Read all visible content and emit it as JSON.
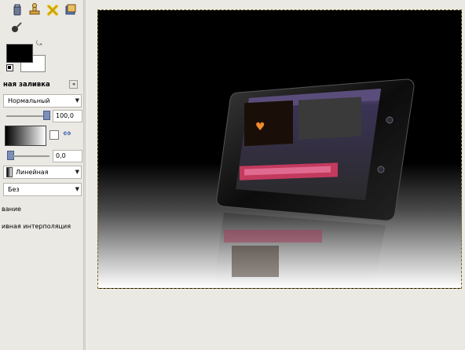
{
  "options": {
    "title": "ная заливка",
    "mode": "Нормальный",
    "opacity": "100,0",
    "offset": "0,0",
    "shape": "Линейная",
    "repeat": "Без",
    "label1": "вание",
    "label2": "ивная интерполяция"
  },
  "colors": {
    "foreground": "#000000",
    "background": "#ffffff"
  },
  "icons": [
    "fuzzy-select-icon",
    "stamp-icon",
    "heal-icon",
    "clone-icon",
    "ink-icon"
  ]
}
